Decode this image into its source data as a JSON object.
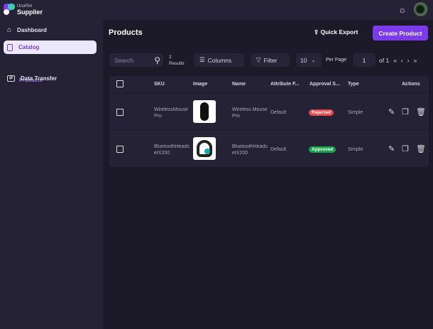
{
  "brand": {
    "small": "UnoPim",
    "big": "Supplier"
  },
  "sidebar": {
    "items": [
      {
        "label": "Dashboard"
      },
      {
        "label": "Catalog"
      },
      {
        "label": "Data Transfer"
      }
    ],
    "sub": "Products"
  },
  "header": {
    "title": "Products",
    "quick_export": "Quick Export",
    "create": "Create Product"
  },
  "toolbar": {
    "search_placeholder": "Search",
    "results_count": "2",
    "results_label": "Results",
    "columns": "Columns",
    "filter": "Filter",
    "per_page_value": "10",
    "per_page_label": "Per Page",
    "page": "1",
    "of": "of 1"
  },
  "table": {
    "headers": [
      "SKU",
      "Image",
      "Name",
      "Attribute F...",
      "Approval S...",
      "Type",
      "Actions"
    ],
    "rows": [
      {
        "sku": "WirelessMousePro",
        "name": "Wireless Mouse Pro",
        "family": "Default",
        "status": "Rejected",
        "status_color": "#e5484d",
        "type": "Simple"
      },
      {
        "sku": "BluetoothHeadsetX200",
        "name": "BluetoothHeadsetX200",
        "family": "Default",
        "status": "Approved",
        "status_color": "#16a34a",
        "type": "Simple"
      }
    ]
  }
}
